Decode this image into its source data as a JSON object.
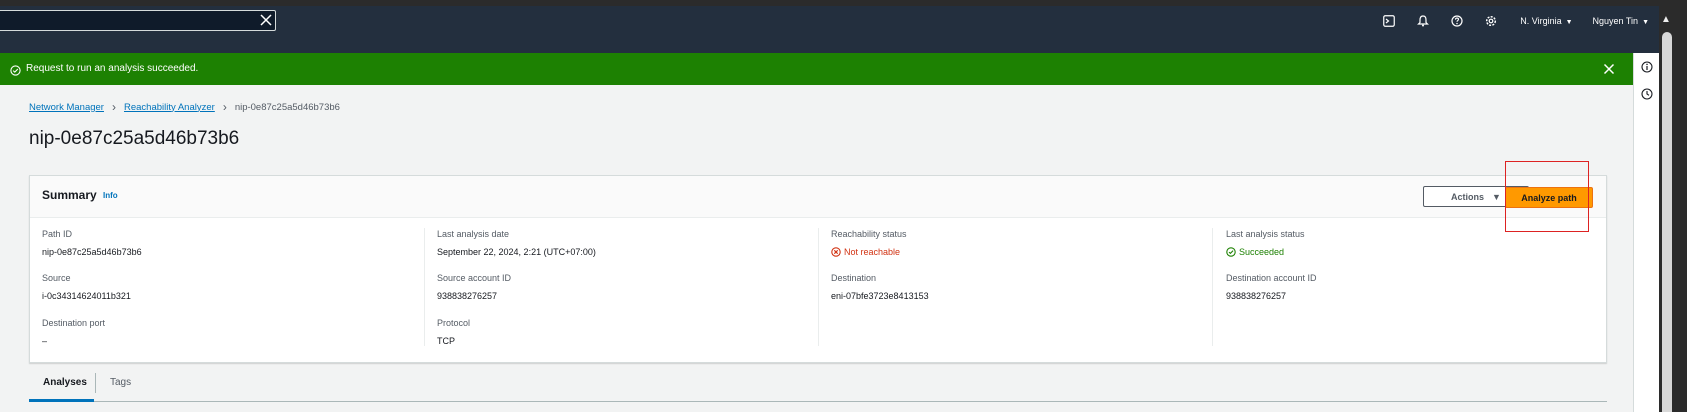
{
  "topbar": {
    "search_value": "",
    "region": "N. Virginia",
    "user": "Nguyen Tin"
  },
  "flash": {
    "message": "Request to run an analysis succeeded.",
    "color": "#1d8102"
  },
  "breadcrumb": {
    "items": [
      "Network Manager",
      "Reachability Analyzer"
    ],
    "current": "nip-0e87c25a5d46b73b6"
  },
  "page": {
    "title": "nip-0e87c25a5d46b73b6"
  },
  "summary": {
    "title": "Summary",
    "info_label": "Info",
    "actions_label": "Actions",
    "analyze_label": "Analyze path",
    "fields": {
      "path_id": {
        "label": "Path ID",
        "value": "nip-0e87c25a5d46b73b6"
      },
      "last_analysis_date": {
        "label": "Last analysis date",
        "value": "September 22, 2024, 2:21 (UTC+07:00)"
      },
      "reachability_status": {
        "label": "Reachability status",
        "value": "Not reachable"
      },
      "last_analysis_status": {
        "label": "Last analysis status",
        "value": "Succeeded"
      },
      "source": {
        "label": "Source",
        "value": "i-0c34314624011b321"
      },
      "source_account_id": {
        "label": "Source account ID",
        "value": "938838276257"
      },
      "destination": {
        "label": "Destination",
        "value": "eni-07bfe3723e8413153"
      },
      "destination_account_id": {
        "label": "Destination account ID",
        "value": "938838276257"
      },
      "destination_port": {
        "label": "Destination port",
        "value": "–"
      },
      "protocol": {
        "label": "Protocol",
        "value": "TCP"
      }
    }
  },
  "tabs": [
    {
      "label": "Analyses",
      "active": true
    },
    {
      "label": "Tags",
      "active": false
    }
  ],
  "colors": {
    "accent": "#0073bb",
    "primary_button": "#ff9900",
    "error": "#d13212",
    "success": "#1d8102"
  }
}
